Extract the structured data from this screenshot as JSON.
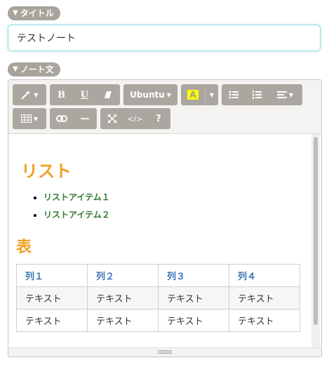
{
  "title_section": {
    "label": "タイトル",
    "value": "テストノート"
  },
  "note_section": {
    "label": "ノート文"
  },
  "toolbar": {
    "font_name": "Ubuntu",
    "bold": "B",
    "underline": "U",
    "help": "?",
    "code": "</>",
    "highlight_letter": "A",
    "hr": "—",
    "highlight_color": "#ffff00",
    "button_color": "#aba69f"
  },
  "content": {
    "list_heading": "リスト",
    "list_items": [
      "リストアイテム１",
      "リストアイテム２"
    ],
    "table_heading": "表",
    "table": {
      "headers": [
        "列１",
        "列２",
        "列３",
        "列４"
      ],
      "rows": [
        [
          "テキスト",
          "テキスト",
          "テキスト",
          "テキスト"
        ],
        [
          "テキスト",
          "テキスト",
          "テキスト",
          "テキスト"
        ]
      ]
    },
    "heading_color": "#f0a024",
    "list_color": "#2f7a2f",
    "table_header_color": "#3b74b8"
  }
}
